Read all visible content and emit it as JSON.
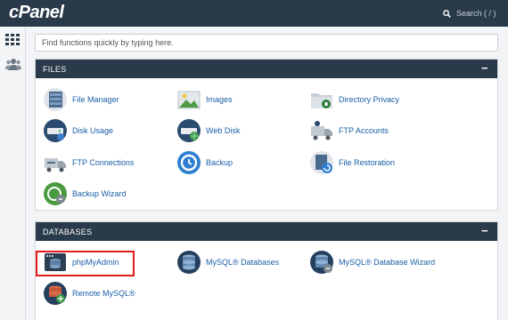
{
  "app": {
    "logo": "cPanel"
  },
  "header": {
    "search_label": "Search ( / )"
  },
  "quick_find": {
    "placeholder": "Find functions quickly by typing here."
  },
  "nav": [
    {
      "name": "apps-grid-icon"
    },
    {
      "name": "users-icon"
    }
  ],
  "files": {
    "title": "FILES",
    "items": [
      {
        "label": "File Manager",
        "icon": "file-manager-icon"
      },
      {
        "label": "Images",
        "icon": "images-icon"
      },
      {
        "label": "Directory Privacy",
        "icon": "directory-privacy-icon"
      },
      {
        "label": "Disk Usage",
        "icon": "disk-usage-icon"
      },
      {
        "label": "Web Disk",
        "icon": "web-disk-icon"
      },
      {
        "label": "FTP Accounts",
        "icon": "ftp-accounts-icon"
      },
      {
        "label": "FTP Connections",
        "icon": "ftp-connections-icon"
      },
      {
        "label": "Backup",
        "icon": "backup-icon"
      },
      {
        "label": "File Restoration",
        "icon": "file-restoration-icon"
      },
      {
        "label": "Backup Wizard",
        "icon": "backup-wizard-icon"
      }
    ]
  },
  "databases": {
    "title": "DATABASES",
    "items": [
      {
        "label": "phpMyAdmin",
        "icon": "phpmyadmin-icon"
      },
      {
        "label": "MySQL® Databases",
        "icon": "mysql-databases-icon"
      },
      {
        "label": "MySQL® Database Wizard",
        "icon": "mysql-wizard-icon"
      },
      {
        "label": "Remote MySQL®",
        "icon": "remote-mysql-icon"
      }
    ]
  },
  "colors": {
    "header": "#293a4a",
    "link": "#1a5ea8",
    "highlight": "#e51b1b"
  }
}
